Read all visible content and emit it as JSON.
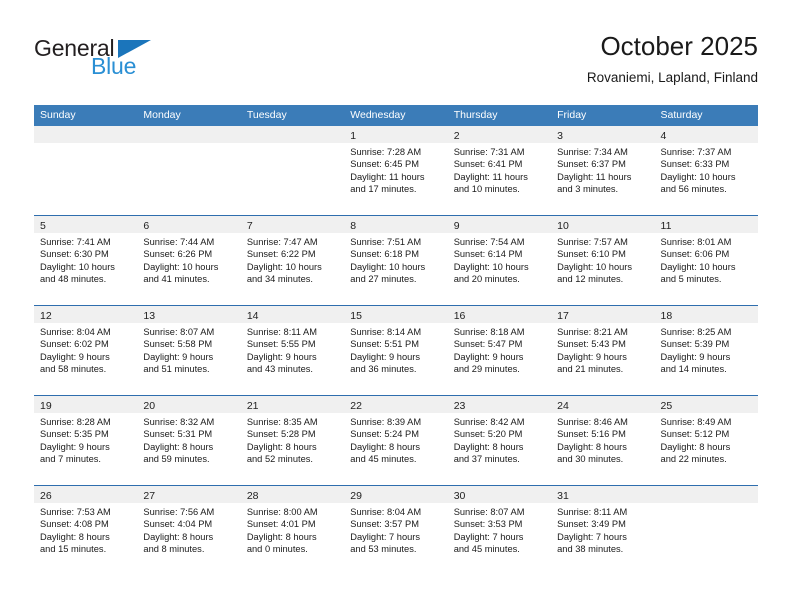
{
  "brand": {
    "name_top": "General",
    "name_bottom": "Blue",
    "triangle_color": "#1b75bb",
    "top_color": "#231f20",
    "bottom_color": "#2a8fd4"
  },
  "header": {
    "title": "October 2025",
    "subtitle": "Rovaniemi, Lapland, Finland"
  },
  "theme": {
    "header_bg": "#3b7cb8",
    "header_text": "#ffffff",
    "row_divider": "#2f6eae",
    "day_band_bg": "#f0f0f0",
    "cell_bg": "#ffffff",
    "body_text": "#1a1a1a"
  },
  "weekdays": [
    "Sunday",
    "Monday",
    "Tuesday",
    "Wednesday",
    "Thursday",
    "Friday",
    "Saturday"
  ],
  "weeks": [
    [
      {
        "day": "",
        "lines": []
      },
      {
        "day": "",
        "lines": []
      },
      {
        "day": "",
        "lines": []
      },
      {
        "day": "1",
        "lines": [
          "Sunrise: 7:28 AM",
          "Sunset: 6:45 PM",
          "Daylight: 11 hours",
          "and 17 minutes."
        ]
      },
      {
        "day": "2",
        "lines": [
          "Sunrise: 7:31 AM",
          "Sunset: 6:41 PM",
          "Daylight: 11 hours",
          "and 10 minutes."
        ]
      },
      {
        "day": "3",
        "lines": [
          "Sunrise: 7:34 AM",
          "Sunset: 6:37 PM",
          "Daylight: 11 hours",
          "and 3 minutes."
        ]
      },
      {
        "day": "4",
        "lines": [
          "Sunrise: 7:37 AM",
          "Sunset: 6:33 PM",
          "Daylight: 10 hours",
          "and 56 minutes."
        ]
      }
    ],
    [
      {
        "day": "5",
        "lines": [
          "Sunrise: 7:41 AM",
          "Sunset: 6:30 PM",
          "Daylight: 10 hours",
          "and 48 minutes."
        ]
      },
      {
        "day": "6",
        "lines": [
          "Sunrise: 7:44 AM",
          "Sunset: 6:26 PM",
          "Daylight: 10 hours",
          "and 41 minutes."
        ]
      },
      {
        "day": "7",
        "lines": [
          "Sunrise: 7:47 AM",
          "Sunset: 6:22 PM",
          "Daylight: 10 hours",
          "and 34 minutes."
        ]
      },
      {
        "day": "8",
        "lines": [
          "Sunrise: 7:51 AM",
          "Sunset: 6:18 PM",
          "Daylight: 10 hours",
          "and 27 minutes."
        ]
      },
      {
        "day": "9",
        "lines": [
          "Sunrise: 7:54 AM",
          "Sunset: 6:14 PM",
          "Daylight: 10 hours",
          "and 20 minutes."
        ]
      },
      {
        "day": "10",
        "lines": [
          "Sunrise: 7:57 AM",
          "Sunset: 6:10 PM",
          "Daylight: 10 hours",
          "and 12 minutes."
        ]
      },
      {
        "day": "11",
        "lines": [
          "Sunrise: 8:01 AM",
          "Sunset: 6:06 PM",
          "Daylight: 10 hours",
          "and 5 minutes."
        ]
      }
    ],
    [
      {
        "day": "12",
        "lines": [
          "Sunrise: 8:04 AM",
          "Sunset: 6:02 PM",
          "Daylight: 9 hours",
          "and 58 minutes."
        ]
      },
      {
        "day": "13",
        "lines": [
          "Sunrise: 8:07 AM",
          "Sunset: 5:58 PM",
          "Daylight: 9 hours",
          "and 51 minutes."
        ]
      },
      {
        "day": "14",
        "lines": [
          "Sunrise: 8:11 AM",
          "Sunset: 5:55 PM",
          "Daylight: 9 hours",
          "and 43 minutes."
        ]
      },
      {
        "day": "15",
        "lines": [
          "Sunrise: 8:14 AM",
          "Sunset: 5:51 PM",
          "Daylight: 9 hours",
          "and 36 minutes."
        ]
      },
      {
        "day": "16",
        "lines": [
          "Sunrise: 8:18 AM",
          "Sunset: 5:47 PM",
          "Daylight: 9 hours",
          "and 29 minutes."
        ]
      },
      {
        "day": "17",
        "lines": [
          "Sunrise: 8:21 AM",
          "Sunset: 5:43 PM",
          "Daylight: 9 hours",
          "and 21 minutes."
        ]
      },
      {
        "day": "18",
        "lines": [
          "Sunrise: 8:25 AM",
          "Sunset: 5:39 PM",
          "Daylight: 9 hours",
          "and 14 minutes."
        ]
      }
    ],
    [
      {
        "day": "19",
        "lines": [
          "Sunrise: 8:28 AM",
          "Sunset: 5:35 PM",
          "Daylight: 9 hours",
          "and 7 minutes."
        ]
      },
      {
        "day": "20",
        "lines": [
          "Sunrise: 8:32 AM",
          "Sunset: 5:31 PM",
          "Daylight: 8 hours",
          "and 59 minutes."
        ]
      },
      {
        "day": "21",
        "lines": [
          "Sunrise: 8:35 AM",
          "Sunset: 5:28 PM",
          "Daylight: 8 hours",
          "and 52 minutes."
        ]
      },
      {
        "day": "22",
        "lines": [
          "Sunrise: 8:39 AM",
          "Sunset: 5:24 PM",
          "Daylight: 8 hours",
          "and 45 minutes."
        ]
      },
      {
        "day": "23",
        "lines": [
          "Sunrise: 8:42 AM",
          "Sunset: 5:20 PM",
          "Daylight: 8 hours",
          "and 37 minutes."
        ]
      },
      {
        "day": "24",
        "lines": [
          "Sunrise: 8:46 AM",
          "Sunset: 5:16 PM",
          "Daylight: 8 hours",
          "and 30 minutes."
        ]
      },
      {
        "day": "25",
        "lines": [
          "Sunrise: 8:49 AM",
          "Sunset: 5:12 PM",
          "Daylight: 8 hours",
          "and 22 minutes."
        ]
      }
    ],
    [
      {
        "day": "26",
        "lines": [
          "Sunrise: 7:53 AM",
          "Sunset: 4:08 PM",
          "Daylight: 8 hours",
          "and 15 minutes."
        ]
      },
      {
        "day": "27",
        "lines": [
          "Sunrise: 7:56 AM",
          "Sunset: 4:04 PM",
          "Daylight: 8 hours",
          "and 8 minutes."
        ]
      },
      {
        "day": "28",
        "lines": [
          "Sunrise: 8:00 AM",
          "Sunset: 4:01 PM",
          "Daylight: 8 hours",
          "and 0 minutes."
        ]
      },
      {
        "day": "29",
        "lines": [
          "Sunrise: 8:04 AM",
          "Sunset: 3:57 PM",
          "Daylight: 7 hours",
          "and 53 minutes."
        ]
      },
      {
        "day": "30",
        "lines": [
          "Sunrise: 8:07 AM",
          "Sunset: 3:53 PM",
          "Daylight: 7 hours",
          "and 45 minutes."
        ]
      },
      {
        "day": "31",
        "lines": [
          "Sunrise: 8:11 AM",
          "Sunset: 3:49 PM",
          "Daylight: 7 hours",
          "and 38 minutes."
        ]
      },
      {
        "day": "",
        "lines": []
      }
    ]
  ]
}
